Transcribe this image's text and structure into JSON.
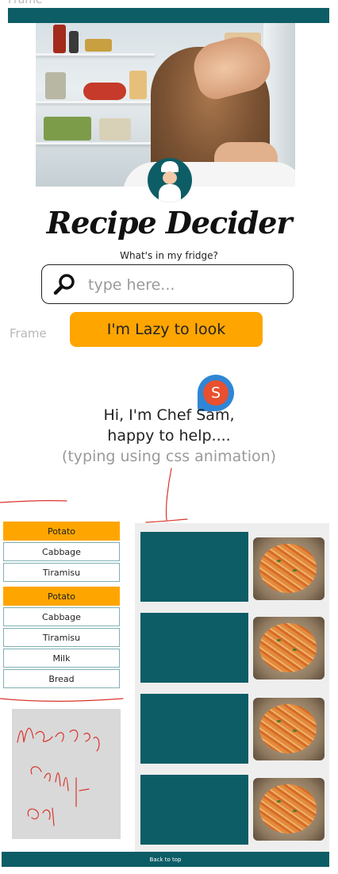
{
  "canvas": {
    "label": "Frame"
  },
  "header": {
    "brand": "Recipe Decider",
    "subtitle": "What's in my fridge?"
  },
  "search": {
    "placeholder": "type here...",
    "value": ""
  },
  "actions": {
    "lazy_label": "I'm Lazy to look"
  },
  "side_label": "Frame",
  "chef": {
    "avatar_letter": "S",
    "greeting_line1": "Hi, I'm Chef Sam,",
    "greeting_line2": "happy to help....",
    "typing_note": "(typing using css animation)"
  },
  "ingredients": [
    {
      "label": "Potato",
      "active": true
    },
    {
      "label": "Cabbage",
      "active": false
    },
    {
      "label": "Tiramisu",
      "active": false
    },
    {
      "label": "Potato",
      "active": true
    },
    {
      "label": "Cabbage",
      "active": false
    },
    {
      "label": "Tiramisu",
      "active": false
    },
    {
      "label": "Milk",
      "active": false
    },
    {
      "label": "Bread",
      "active": false
    }
  ],
  "recipes": [
    {
      "image": "pasta-image"
    },
    {
      "image": "pasta-image"
    },
    {
      "image": "pasta-image"
    },
    {
      "image": "pasta-image"
    }
  ],
  "footer": {
    "back_to_top": "Back to top"
  },
  "colors": {
    "teal": "#0d5d66",
    "accent": "#ffa500",
    "avatar": "#e8502f",
    "bubble": "#2f86d6"
  }
}
